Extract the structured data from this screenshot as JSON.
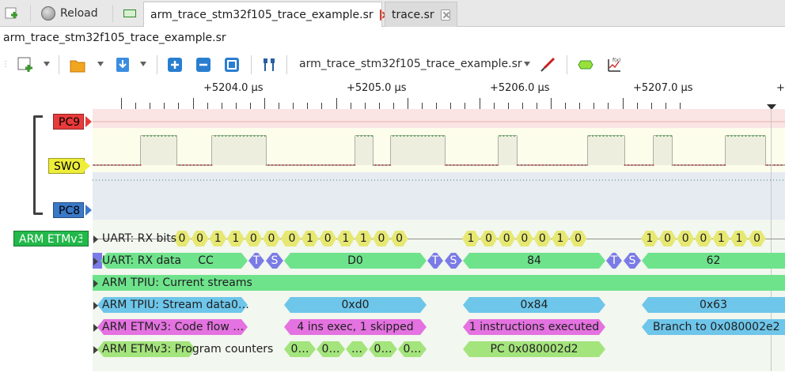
{
  "tabbar": {
    "reload_label": "Reload",
    "tabs": [
      {
        "label": "arm_trace_stm32f105_trace_example.sr",
        "active": true
      },
      {
        "label": "trace.sr",
        "active": false
      }
    ]
  },
  "session": {
    "title": "arm_trace_stm32f105_trace_example.sr"
  },
  "toolbar": {
    "device_label": "arm_trace_stm32f105_trace_example.sr"
  },
  "ruler": {
    "labels": [
      "+5204.0 µs",
      "+5205.0 µs",
      "+5206.0 µs",
      "+5207.0 µs",
      "+5"
    ]
  },
  "channels": [
    {
      "name": "PC9",
      "color": "#e83a3a"
    },
    {
      "name": "SWO",
      "color": "#eeee3a"
    },
    {
      "name": "PC8",
      "color": "#3a78c8"
    }
  ],
  "decoder": {
    "name": "ARM ETMv3",
    "color": "#22b84a",
    "rows": [
      {
        "label": "UART: RX bits",
        "bits": [
          "0",
          "0",
          "1",
          "1",
          "0",
          "0",
          "0",
          "0",
          "1",
          "0",
          "1",
          "1",
          "0",
          "0",
          "1",
          "0",
          "0",
          "0",
          "0",
          "1",
          "0",
          "1",
          "0",
          "0",
          "0",
          "1",
          "1",
          "0"
        ]
      },
      {
        "label": "UART: RX data",
        "segments": [
          "CC",
          "T",
          "S",
          "D0",
          "T",
          "S",
          "84",
          "T",
          "S",
          "62"
        ]
      },
      {
        "label": "ARM TPIU: Current streams"
      },
      {
        "label": "ARM TPIU: Stream data",
        "label_full": "ARM TPIU: Stream data0…",
        "values": [
          "0xd0",
          "0x84",
          "0x63"
        ]
      },
      {
        "label": "ARM ETMv3: Code flow …",
        "values": [
          "4 ins exec, 1 skipped",
          "1 instructions executed",
          "Branch to 0x080002e2"
        ]
      },
      {
        "label": "ARM ETMv3: Program counters",
        "values": [
          "0…",
          "0…",
          "…",
          "0…",
          "0…",
          "PC 0x080002d2"
        ]
      }
    ]
  }
}
